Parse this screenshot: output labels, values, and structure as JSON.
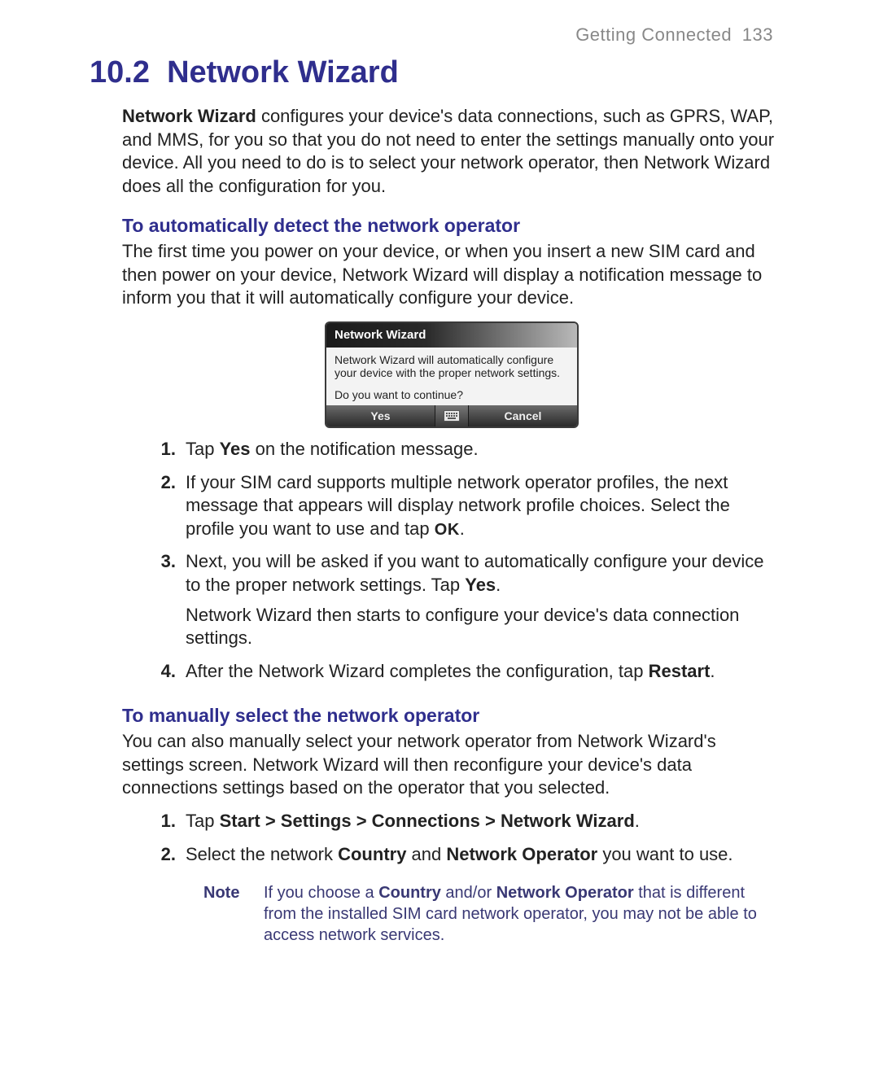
{
  "header": {
    "chapter": "Getting Connected",
    "page_number": "133"
  },
  "section": {
    "number": "10.2",
    "title": "Network Wizard"
  },
  "intro": {
    "lead": "Network Wizard",
    "rest": " configures your device's data connections, such as GPRS, WAP, and MMS, for you so that you do not need to enter the settings manually onto your device. All you need to do is to select your network operator, then Network Wizard does all the configuration for you."
  },
  "auto": {
    "heading": "To automatically detect the network operator",
    "para": "The first time you power on your device, or when you insert a new SIM card and then power on your device, Network Wizard will display a notification message to inform you that it will automatically configure your device."
  },
  "dialog": {
    "title": "Network Wizard",
    "line1": "Network Wizard will automatically configure your device with the proper network settings.",
    "line2": "Do you want to continue?",
    "yes": "Yes",
    "cancel": "Cancel"
  },
  "auto_steps": {
    "s1_pre": "Tap ",
    "s1_b": "Yes",
    "s1_post": " on the notification message.",
    "s2_pre": "If your SIM card supports multiple network operator profiles, the next message that appears will display network profile choices. Select the profile you want to use and tap ",
    "s2_b": "OK",
    "s2_post": ".",
    "s3_pre": "Next, you will be asked if you want to automatically configure your device to the proper network settings. Tap ",
    "s3_b": "Yes",
    "s3_post": ".",
    "s3_p2": "Network Wizard then starts to configure your device's data connection settings.",
    "s4_pre": "After the Network Wizard completes the configuration, tap ",
    "s4_b": "Restart",
    "s4_post": "."
  },
  "manual": {
    "heading": "To manually select the network operator",
    "para": "You can also manually select your network operator from Network Wizard's settings screen. Network Wizard will then reconfigure your device's data connections settings based on the operator that you selected.",
    "s1_pre": "Tap ",
    "s1_b": "Start > Settings > Connections > Network Wizard",
    "s1_post": ".",
    "s2_pre": "Select the network ",
    "s2_b1": "Country",
    "s2_mid": " and ",
    "s2_b2": "Network Operator",
    "s2_post": " you want to use."
  },
  "note": {
    "label": "Note",
    "t1": "If you choose a ",
    "b1": "Country",
    "t2": " and/or ",
    "b2": "Network Operator",
    "t3": " that is different from the installed SIM card network operator, you may not be able to access network services."
  },
  "nums": {
    "n1": "1.",
    "n2": "2.",
    "n3": "3.",
    "n4": "4."
  }
}
